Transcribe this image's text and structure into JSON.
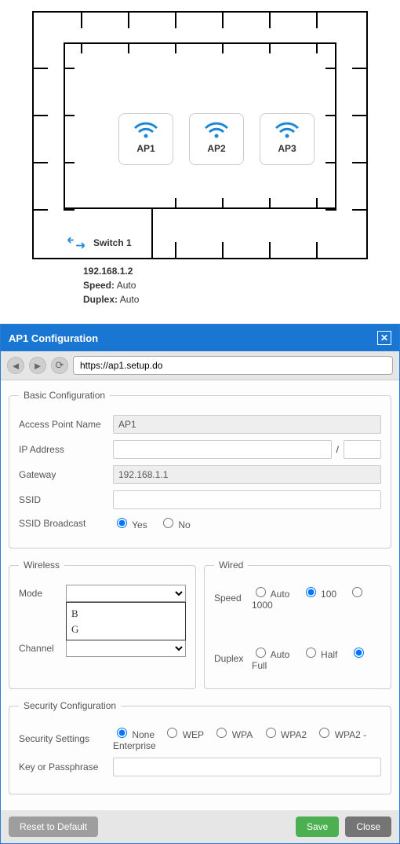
{
  "floorplan": {
    "ap": [
      "AP1",
      "AP2",
      "AP3"
    ],
    "switch_label": "Switch 1",
    "switch_ip": "192.168.1.2",
    "switch_speed_label": "Speed:",
    "switch_speed_value": "Auto",
    "switch_duplex_label": "Duplex:",
    "switch_duplex_value": "Auto"
  },
  "config": {
    "title": "AP1 Configuration",
    "url": "https://ap1.setup.do",
    "basic": {
      "legend": "Basic Configuration",
      "ap_name_label": "Access Point Name",
      "ap_name_value": "AP1",
      "ip_label": "IP Address",
      "ip_value": "",
      "mask_value": "",
      "gateway_label": "Gateway",
      "gateway_value": "192.168.1.1",
      "ssid_label": "SSID",
      "ssid_value": "",
      "ssid_bcast_label": "SSID Broadcast",
      "ssid_bcast_yes": "Yes",
      "ssid_bcast_no": "No"
    },
    "wireless": {
      "legend": "Wireless",
      "mode_label": "Mode",
      "mode_options": [
        "B",
        "G"
      ],
      "channel_label": "Channel"
    },
    "wired": {
      "legend": "Wired",
      "speed_label": "Speed",
      "speed_options": [
        "Auto",
        "100",
        "1000"
      ],
      "speed_selected": "100",
      "duplex_label": "Duplex",
      "duplex_options": [
        "Auto",
        "Half",
        "Full"
      ],
      "duplex_selected": "Full"
    },
    "security": {
      "legend": "Security Configuration",
      "settings_label": "Security Settings",
      "options": [
        "None",
        "WEP",
        "WPA",
        "WPA2",
        "WPA2 - Enterprise"
      ],
      "selected": "None",
      "key_label": "Key or Passphrase",
      "key_value": ""
    },
    "buttons": {
      "reset": "Reset to Default",
      "save": "Save",
      "close": "Close"
    }
  }
}
